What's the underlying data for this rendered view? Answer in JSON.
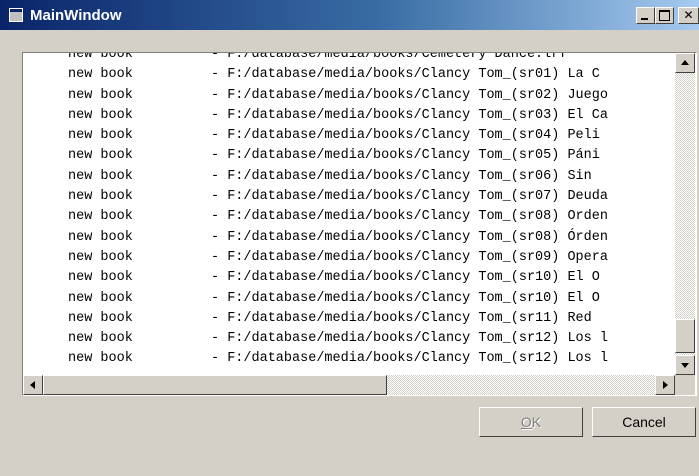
{
  "window": {
    "title": "MainWindow"
  },
  "list": {
    "rows": [
      {
        "type": "new book",
        "path": "- F:/database/media/books/Cemetery Dance.lrf"
      },
      {
        "type": "new book",
        "path": "- F:/database/media/books/Clancy Tom_(sr01) La C"
      },
      {
        "type": "new book",
        "path": "- F:/database/media/books/Clancy Tom_(sr02) Juego"
      },
      {
        "type": "new book",
        "path": "- F:/database/media/books/Clancy Tom_(sr03) El Ca"
      },
      {
        "type": "new book",
        "path": "- F:/database/media/books/Clancy Tom_(sr04) Peli"
      },
      {
        "type": "new book",
        "path": "- F:/database/media/books/Clancy Tom_(sr05) Páni"
      },
      {
        "type": "new book",
        "path": "- F:/database/media/books/Clancy Tom_(sr06) Sin "
      },
      {
        "type": "new book",
        "path": "- F:/database/media/books/Clancy Tom_(sr07) Deuda"
      },
      {
        "type": "new book",
        "path": "- F:/database/media/books/Clancy Tom_(sr08) Orden"
      },
      {
        "type": "new book",
        "path": "- F:/database/media/books/Clancy Tom_(sr08) Órden"
      },
      {
        "type": "new book",
        "path": "- F:/database/media/books/Clancy Tom_(sr09) Opera"
      },
      {
        "type": "new book",
        "path": "- F:/database/media/books/Clancy Tom_(sr10) El O"
      },
      {
        "type": "new book",
        "path": "- F:/database/media/books/Clancy Tom_(sr10) El O"
      },
      {
        "type": "new book",
        "path": "- F:/database/media/books/Clancy Tom_(sr11) Red "
      },
      {
        "type": "new book",
        "path": "- F:/database/media/books/Clancy Tom_(sr12) Los l"
      },
      {
        "type": "new book",
        "path": "- F:/database/media/books/Clancy Tom_(sr12) Los l"
      }
    ]
  },
  "buttons": {
    "ok_mnemonic": "O",
    "ok_rest": "K",
    "cancel": "Cancel"
  },
  "scroll": {
    "vertical_position": 0.93,
    "horizontal_position": 0.0
  }
}
